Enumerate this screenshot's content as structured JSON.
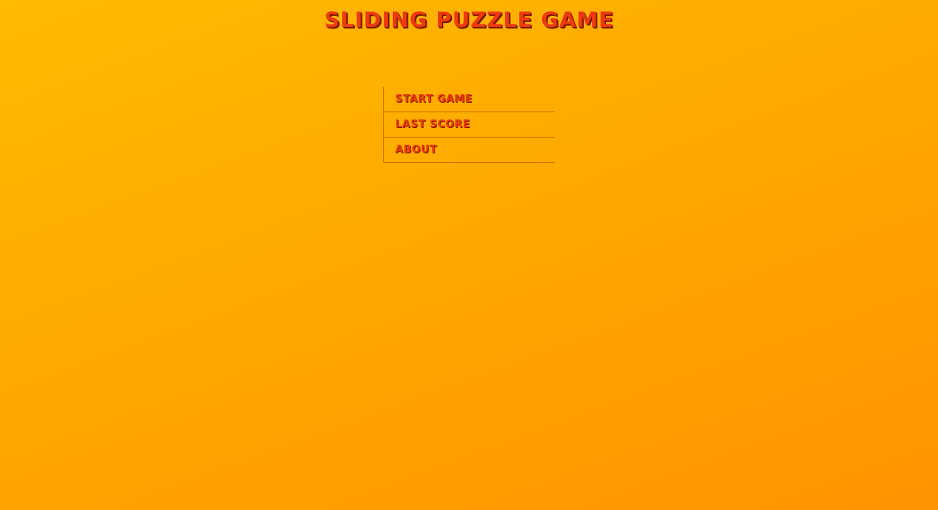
{
  "game": {
    "title": "Sliding Puzzle Game"
  },
  "menu": {
    "items": [
      {
        "label": "Start Game"
      },
      {
        "label": "Last Score"
      },
      {
        "label": "About"
      }
    ]
  },
  "colors": {
    "background_top": "#ffbb00",
    "background_bottom": "#ff9400",
    "text": "#ee3b0c",
    "divider": "#c77400"
  }
}
